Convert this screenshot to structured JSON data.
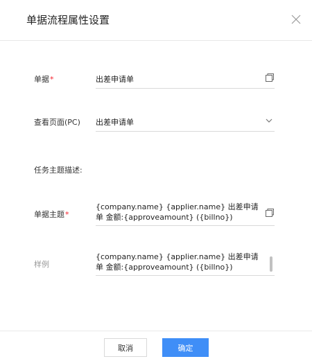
{
  "dialog": {
    "title": "单据流程属性设置",
    "close_icon": "close-icon"
  },
  "form": {
    "bill": {
      "label": "单据",
      "required_mark": "*",
      "value": "出差申请单",
      "icon": "copy-icon"
    },
    "view_page": {
      "label": "查看页面(PC)",
      "value": "出差申请单",
      "icon": "chevron-down-icon"
    },
    "task_desc_label": "任务主题描述:",
    "bill_subject": {
      "label": "单据主题",
      "required_mark": "*",
      "value": "{company.name} {applier.name} 出差申请单 金额:{approveamount} ({billno})",
      "icon": "copy-icon"
    },
    "sample": {
      "label": "样例",
      "value": "{company.name} {applier.name} 出差申请单 金额:{approveamount} ({billno})"
    }
  },
  "footer": {
    "cancel_label": "取消",
    "ok_label": "确定"
  },
  "colors": {
    "primary": "#3f8ef7",
    "required": "#f5222d"
  }
}
